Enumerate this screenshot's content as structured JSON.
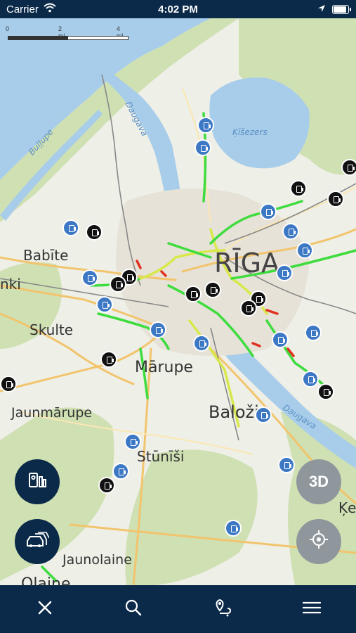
{
  "status_bar": {
    "carrier": "Carrier",
    "time": "4:02 PM"
  },
  "scale": {
    "t0": "0",
    "t1": "2 mi",
    "t2": "4 mi"
  },
  "places": {
    "riga": "RĪGA",
    "babite": "Babīte",
    "nki": "nki",
    "skulte": "Skulte",
    "marupe": "Mārupe",
    "jaunmarupe": "Jaunmārupe",
    "balozi": "Baloži",
    "stunisi": "Stūnīši",
    "jaunolaine": "Jaunolaine",
    "olaine": "Olaine",
    "ke": "Ķe"
  },
  "water": {
    "daugava_north": "Daugava",
    "bullupe": "Buļļupe",
    "kisezers": "Ķīšezers",
    "daugava_south": "Daugava"
  },
  "map_buttons": {
    "threed": "3D"
  },
  "colors": {
    "navy": "#0b2a4a",
    "camera_blue": "#3d78c5",
    "traffic_green": "#3fdc3f",
    "traffic_yellow": "#d8e84a",
    "traffic_red": "#e0301e"
  },
  "icons": {
    "speed_camera_button": "speed-camera-icon",
    "traffic_button": "cars-icon",
    "locate_button": "crosshair-icon",
    "toolbar": [
      "close-icon",
      "search-icon",
      "route-pin-icon",
      "menu-icon"
    ]
  }
}
